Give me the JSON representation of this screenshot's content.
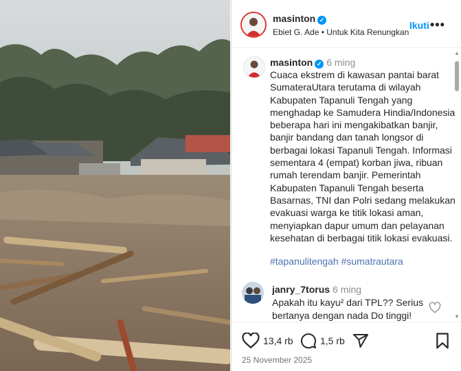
{
  "post": {
    "username": "masinton",
    "music": "Ebiet G. Ade • Untuk Kita Renungkan",
    "follow_label": "Ikuti",
    "more_label": "•••",
    "caption_time": "6 ming",
    "caption_text": "Cuaca ekstrem di kawasan pantai barat SumateraUtara terutama di wilayah Kabupaten Tapanuli Tengah yang menghadap ke Samudera Hindia/Indonesia beberapa hari ini mengakibatkan banjir, banjir bandang dan tanah longsor di berbagai lokasi Tapanuli Tengah. Informasi sementara 4 (empat) korban jiwa, ribuan rumah terendam banjir. Pemerintah Kabupaten Tapanuli Tengah beserta Basarnas, TNI dan Polri sedang melakukan evakuasi warga ke titik lokasi aman, menyiapkan dapur umum dan pelayanan kesehatan di berbagai titik lokasi evakuasi.",
    "hashtags": [
      "#tapanulitengah",
      "#sumatrautara"
    ],
    "likes": "13,4 rb",
    "comments": "1,5 rb",
    "date": "25 November 2025"
  },
  "reply": {
    "username": "janry_7torus",
    "time": "6 ming",
    "text": "Apakah itu kayu² dari TPL?? Serius bertanya dengan nada Do tinggi!"
  },
  "icons": {
    "like": "heart-icon",
    "comment": "comment-bubble-icon",
    "share": "send-icon",
    "save": "bookmark-icon",
    "verified": "verified-badge-icon"
  },
  "colors": {
    "accent": "#0095f6",
    "hashtag": "#4c72b0",
    "secondary_text": "#8e8e8e"
  }
}
